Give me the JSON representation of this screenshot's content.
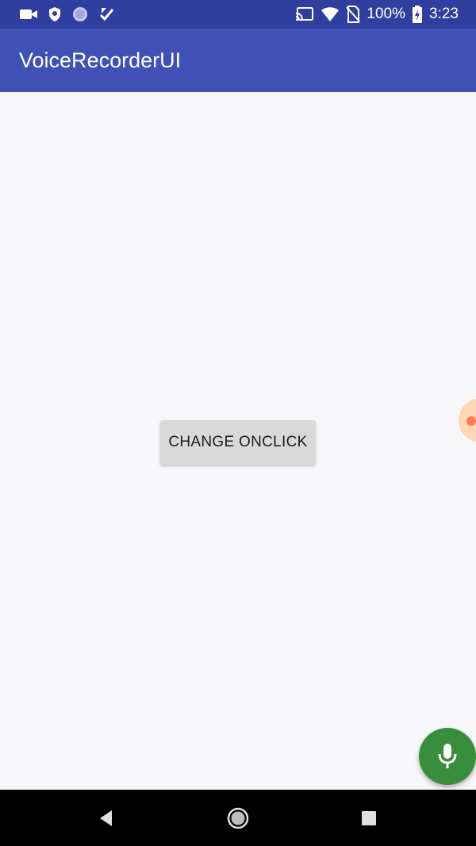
{
  "status_bar": {
    "battery_percent": "100%",
    "time": "3:23",
    "left_icons": [
      "video-camera-icon",
      "shield-icon",
      "globe-icon",
      "download-check-icon"
    ],
    "right_icons": [
      "cast-icon",
      "wifi-icon",
      "no-sim-icon",
      "battery-charging-icon"
    ]
  },
  "app_bar": {
    "title": "VoiceRecorderUI",
    "color": "#3f51b5",
    "status_color": "#303f9f"
  },
  "main": {
    "change_button_label": "CHANGE ONCLICK"
  },
  "fab": {
    "icon": "microphone-icon",
    "color": "#388e3c"
  },
  "nav_bar": {
    "icons": [
      "back-icon",
      "home-icon",
      "recents-icon"
    ]
  }
}
